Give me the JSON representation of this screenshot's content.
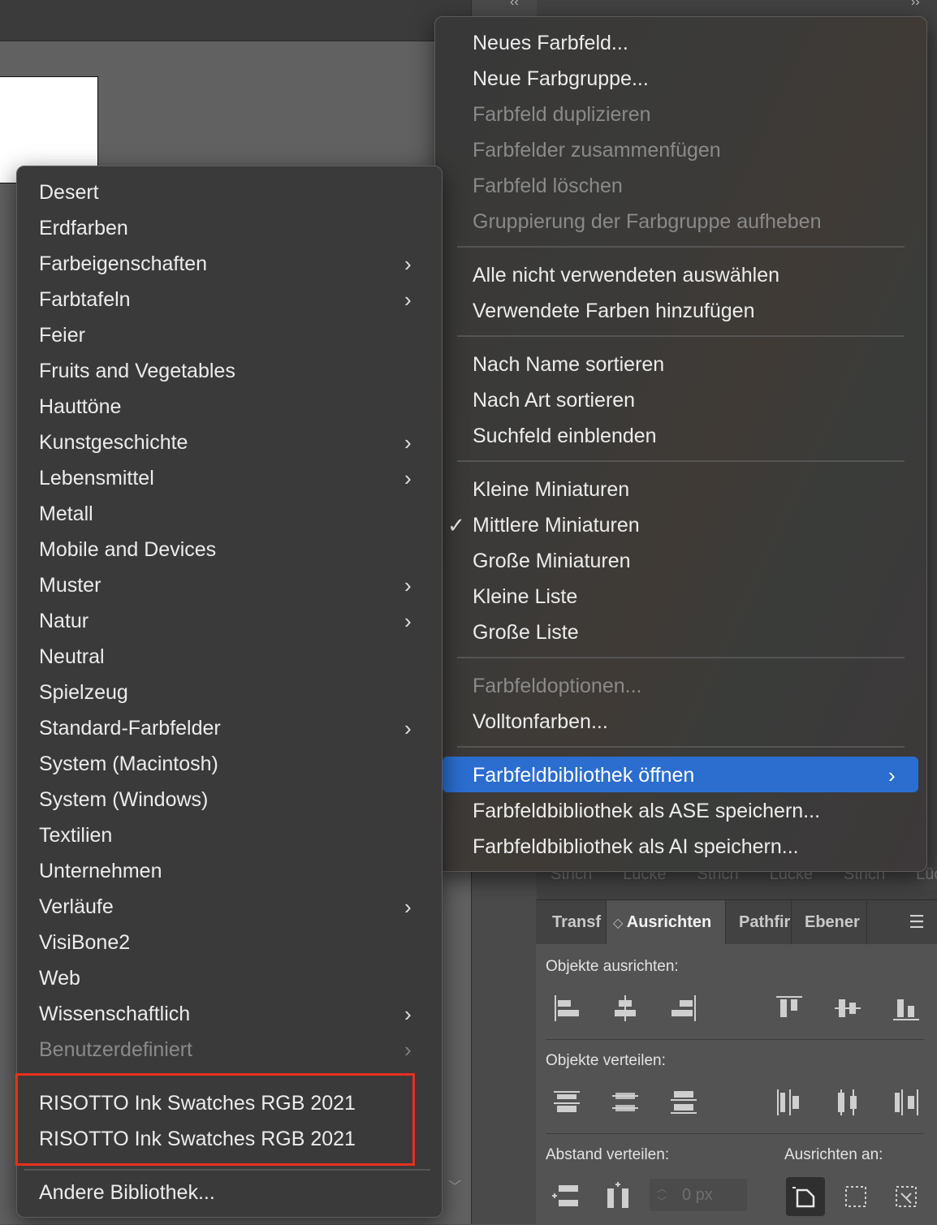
{
  "options_menu": {
    "items": [
      {
        "label": "Neues Farbfeld...",
        "disabled": false
      },
      {
        "label": "Neue Farbgruppe...",
        "disabled": false
      },
      {
        "label": "Farbfeld duplizieren",
        "disabled": true
      },
      {
        "label": "Farbfelder zusammenfügen",
        "disabled": true
      },
      {
        "label": "Farbfeld löschen",
        "disabled": true
      },
      {
        "label": "Gruppierung der Farbgruppe aufheben",
        "disabled": true
      },
      {
        "label": "Alle nicht verwendeten auswählen",
        "disabled": false
      },
      {
        "label": "Verwendete Farben hinzufügen",
        "disabled": false
      },
      {
        "label": "Nach Name sortieren",
        "disabled": false
      },
      {
        "label": "Nach Art sortieren",
        "disabled": false
      },
      {
        "label": "Suchfeld einblenden",
        "disabled": false
      },
      {
        "label": "Kleine Miniaturen",
        "disabled": false
      },
      {
        "label": "Mittlere Miniaturen",
        "disabled": false,
        "checked": true
      },
      {
        "label": "Große Miniaturen",
        "disabled": false
      },
      {
        "label": "Kleine Liste",
        "disabled": false
      },
      {
        "label": "Große Liste",
        "disabled": false
      },
      {
        "label": "Farbfeldoptionen...",
        "disabled": true
      },
      {
        "label": "Volltonfarben...",
        "disabled": false
      },
      {
        "label": "Farbfeldbibliothek öffnen",
        "disabled": false,
        "highlighted": true,
        "submenu": true
      },
      {
        "label": "Farbfeldbibliothek als ASE speichern...",
        "disabled": false
      },
      {
        "label": "Farbfeldbibliothek als AI speichern...",
        "disabled": false
      }
    ],
    "check_glyph": "✓",
    "highlight_color": "#2b6ed0"
  },
  "library_submenu": {
    "items": [
      {
        "label": "Desert",
        "submenu": false
      },
      {
        "label": "Erdfarben",
        "submenu": false
      },
      {
        "label": "Farbeigenschaften",
        "submenu": true
      },
      {
        "label": "Farbtafeln",
        "submenu": true
      },
      {
        "label": "Feier",
        "submenu": false
      },
      {
        "label": "Fruits and Vegetables",
        "submenu": false
      },
      {
        "label": "Hauttöne",
        "submenu": false
      },
      {
        "label": "Kunstgeschichte",
        "submenu": true
      },
      {
        "label": "Lebensmittel",
        "submenu": true
      },
      {
        "label": "Metall",
        "submenu": false
      },
      {
        "label": "Mobile and Devices",
        "submenu": false
      },
      {
        "label": "Muster",
        "submenu": true
      },
      {
        "label": "Natur",
        "submenu": true
      },
      {
        "label": "Neutral",
        "submenu": false
      },
      {
        "label": "Spielzeug",
        "submenu": false
      },
      {
        "label": "Standard-Farbfelder",
        "submenu": true
      },
      {
        "label": "System (Macintosh)",
        "submenu": false
      },
      {
        "label": "System (Windows)",
        "submenu": false
      },
      {
        "label": "Textilien",
        "submenu": false
      },
      {
        "label": "Unternehmen",
        "submenu": false
      },
      {
        "label": "Verläufe",
        "submenu": true
      },
      {
        "label": "VisiBone2",
        "submenu": false
      },
      {
        "label": "Web",
        "submenu": false
      },
      {
        "label": "Wissenschaftlich",
        "submenu": true
      },
      {
        "label": "Benutzerdefiniert",
        "submenu": true,
        "disabled": true
      },
      {
        "label": "RISOTTO Ink Swatches RGB 2021",
        "submenu": false
      },
      {
        "label": "RISOTTO Ink Swatches RGB 2021",
        "submenu": false
      },
      {
        "label": "Andere Bibliothek...",
        "submenu": false
      }
    ],
    "annotation_color": "#e8301e"
  },
  "panel_strip": {
    "labels": [
      "Strich",
      "Lücke",
      "Strich",
      "Lücke",
      "Strich",
      "Lücke"
    ]
  },
  "align_panel": {
    "tabs": [
      "Transf",
      "Ausrichten",
      "Pathfir",
      "Ebener"
    ],
    "active_tab": "Ausrichten",
    "align_objects_label": "Objekte ausrichten:",
    "distribute_objects_label": "Objekte verteilen:",
    "distribute_spacing_label": "Abstand verteilen:",
    "align_to_label": "Ausrichten an:",
    "spacing_value": "0 px"
  },
  "chrome": {
    "collapse_left": "‹‹",
    "collapse_right": "››"
  }
}
